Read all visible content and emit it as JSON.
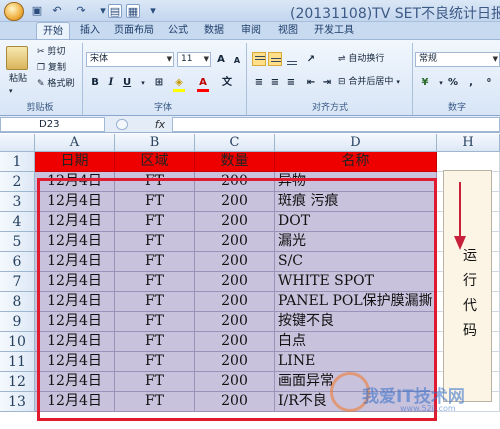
{
  "window": {
    "title": "(20131108)TV SET不良统计日报"
  },
  "ribbon": {
    "tabs": [
      "开始",
      "插入",
      "页面布局",
      "公式",
      "数据",
      "审阅",
      "视图",
      "开发工具"
    ],
    "clipboard": {
      "paste": "粘贴",
      "cut": "剪切",
      "copy": "复制",
      "format_painter": "格式刷",
      "label": "剪贴板"
    },
    "font": {
      "name": "宋体",
      "size": "11",
      "bold": "B",
      "italic": "I",
      "underline": "U",
      "label": "字体"
    },
    "alignment": {
      "wrap": "自动换行",
      "merge": "合并后居中",
      "label": "对齐方式"
    },
    "number": {
      "format": "常规",
      "percent": "%",
      "comma": ",",
      "label": "数字"
    }
  },
  "formula_bar": {
    "name_box": "D23",
    "fx": "fx",
    "value": ""
  },
  "sheet": {
    "columns": [
      "A",
      "B",
      "C",
      "D",
      "H"
    ],
    "row_numbers": [
      "1",
      "2",
      "3",
      "4",
      "5",
      "6",
      "7",
      "8",
      "9",
      "10",
      "11",
      "12",
      "13"
    ],
    "header": [
      "日期",
      "区域",
      "数量",
      "名称"
    ],
    "rows": [
      [
        "12月4日",
        "FT",
        "200",
        "异物"
      ],
      [
        "12月4日",
        "FT",
        "200",
        "斑痕 污痕"
      ],
      [
        "12月4日",
        "FT",
        "200",
        "DOT"
      ],
      [
        "12月4日",
        "FT",
        "200",
        "漏光"
      ],
      [
        "12月4日",
        "FT",
        "200",
        "S/C"
      ],
      [
        "12月4日",
        "FT",
        "200",
        "WHITE SPOT"
      ],
      [
        "12月4日",
        "FT",
        "200",
        "PANEL POL保护膜漏撕"
      ],
      [
        "12月4日",
        "FT",
        "200",
        "按键不良"
      ],
      [
        "12月4日",
        "FT",
        "200",
        "白点"
      ],
      [
        "12月4日",
        "FT",
        "200",
        "LINE"
      ],
      [
        "12月4日",
        "FT",
        "200",
        "画面异常"
      ],
      [
        "12月4日",
        "FT",
        "200",
        "I/R不良"
      ]
    ],
    "selection_color": "#e11b2f",
    "header_fill": "#ef0000",
    "data_fill": "#c9c2dc"
  },
  "annotation": {
    "text": "运行代码"
  },
  "watermark": {
    "main": "我爱IT技术网",
    "sub": "www.52ij.com"
  }
}
